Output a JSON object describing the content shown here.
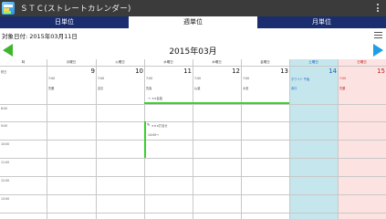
{
  "app": {
    "title": "ＳＴＣ(ストレートカレンダー)"
  },
  "tabs": [
    {
      "label": "日単位",
      "active": false
    },
    {
      "label": "週単位",
      "active": true
    },
    {
      "label": "月単位",
      "active": false
    }
  ],
  "target_date": {
    "label": "対象日付: 2015年03月11日"
  },
  "month_nav": {
    "title": "2015年03月"
  },
  "week": {
    "time_header": "時",
    "days": [
      {
        "dow": "月曜日",
        "day": "9",
        "lines": [
          "7:00",
          "先勝"
        ]
      },
      {
        "dow": "火曜日",
        "day": "10",
        "lines": [
          "7:00",
          "友引"
        ]
      },
      {
        "dow": "水曜日",
        "day": "11",
        "lines": [
          "7:00",
          "先負"
        ]
      },
      {
        "dow": "木曜日",
        "day": "12",
        "lines": [
          "7:00",
          "仏滅"
        ]
      },
      {
        "dow": "金曜日",
        "day": "13",
        "lines": [
          "7:00",
          "大安"
        ]
      },
      {
        "dow": "土曜日",
        "day": "14",
        "lines": [
          "ホワイト 午後",
          "赤口"
        ]
      },
      {
        "dow": "日曜日",
        "day": "15",
        "lines": [
          "7:00",
          "先勝"
        ]
      }
    ],
    "time_rows": [
      "終日",
      "",
      "8:00",
      "9:00",
      "10:00",
      "11:00",
      "12:00",
      "13:00"
    ],
    "events": {
      "wed_allday": "〜 ××会議",
      "wed_event_title": "×××打合せ",
      "wed_event_sub": "14:00〜"
    }
  },
  "colors": {
    "green_highlight": "#3ad12e",
    "tab_bar": "#1a2d6e",
    "appbar": "#3b3b3b",
    "sat_bg": "#c4e6ec",
    "sun_bg": "#fde2e2"
  }
}
